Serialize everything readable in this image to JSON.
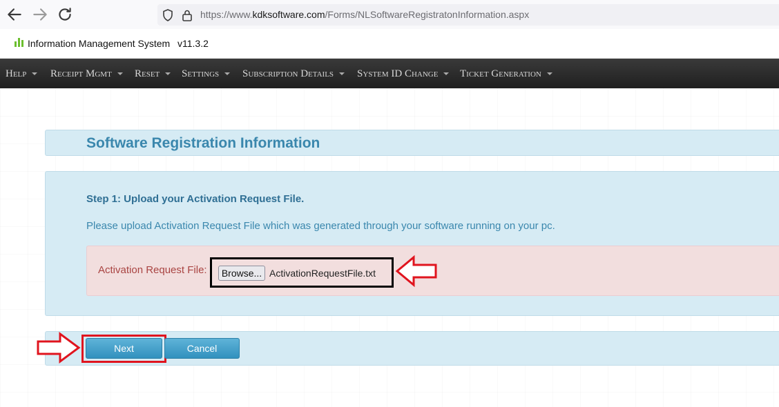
{
  "browser": {
    "url_prefix": "https://www.",
    "url_host": "kdksoftware.com",
    "url_path": "/Forms/NLSoftwareRegistratonInformation.aspx"
  },
  "app": {
    "title": "Information Management System",
    "version": "v11.3.2"
  },
  "menu": {
    "items": [
      {
        "label": "Help"
      },
      {
        "label": "Receipt Mgmt"
      },
      {
        "label": "Reset"
      },
      {
        "label": "Settings"
      },
      {
        "label": "Subscription Details"
      },
      {
        "label": "System ID Change"
      },
      {
        "label": "Ticket Generation"
      }
    ]
  },
  "page": {
    "title": "Software Registration Information",
    "step_title": "Step 1: Upload your Activation Request File.",
    "step_description": "Please upload Activation Request File which was generated through your software running on your pc."
  },
  "upload": {
    "label": "Activation Request File:",
    "browse_label": "Browse...",
    "file_name": "ActivationRequestFile.txt"
  },
  "actions": {
    "next_label": "Next",
    "cancel_label": "Cancel"
  },
  "colors": {
    "accent": "#3a87ad",
    "menu_bg": "#2a2a2a",
    "highlight_red": "#e0141e",
    "error_bg": "#f2dede"
  },
  "icons": {
    "back": "arrow-left-icon",
    "forward": "arrow-right-icon",
    "reload": "reload-icon",
    "shield": "shield-icon",
    "lock": "lock-icon",
    "logo": "bar-chart-icon"
  }
}
